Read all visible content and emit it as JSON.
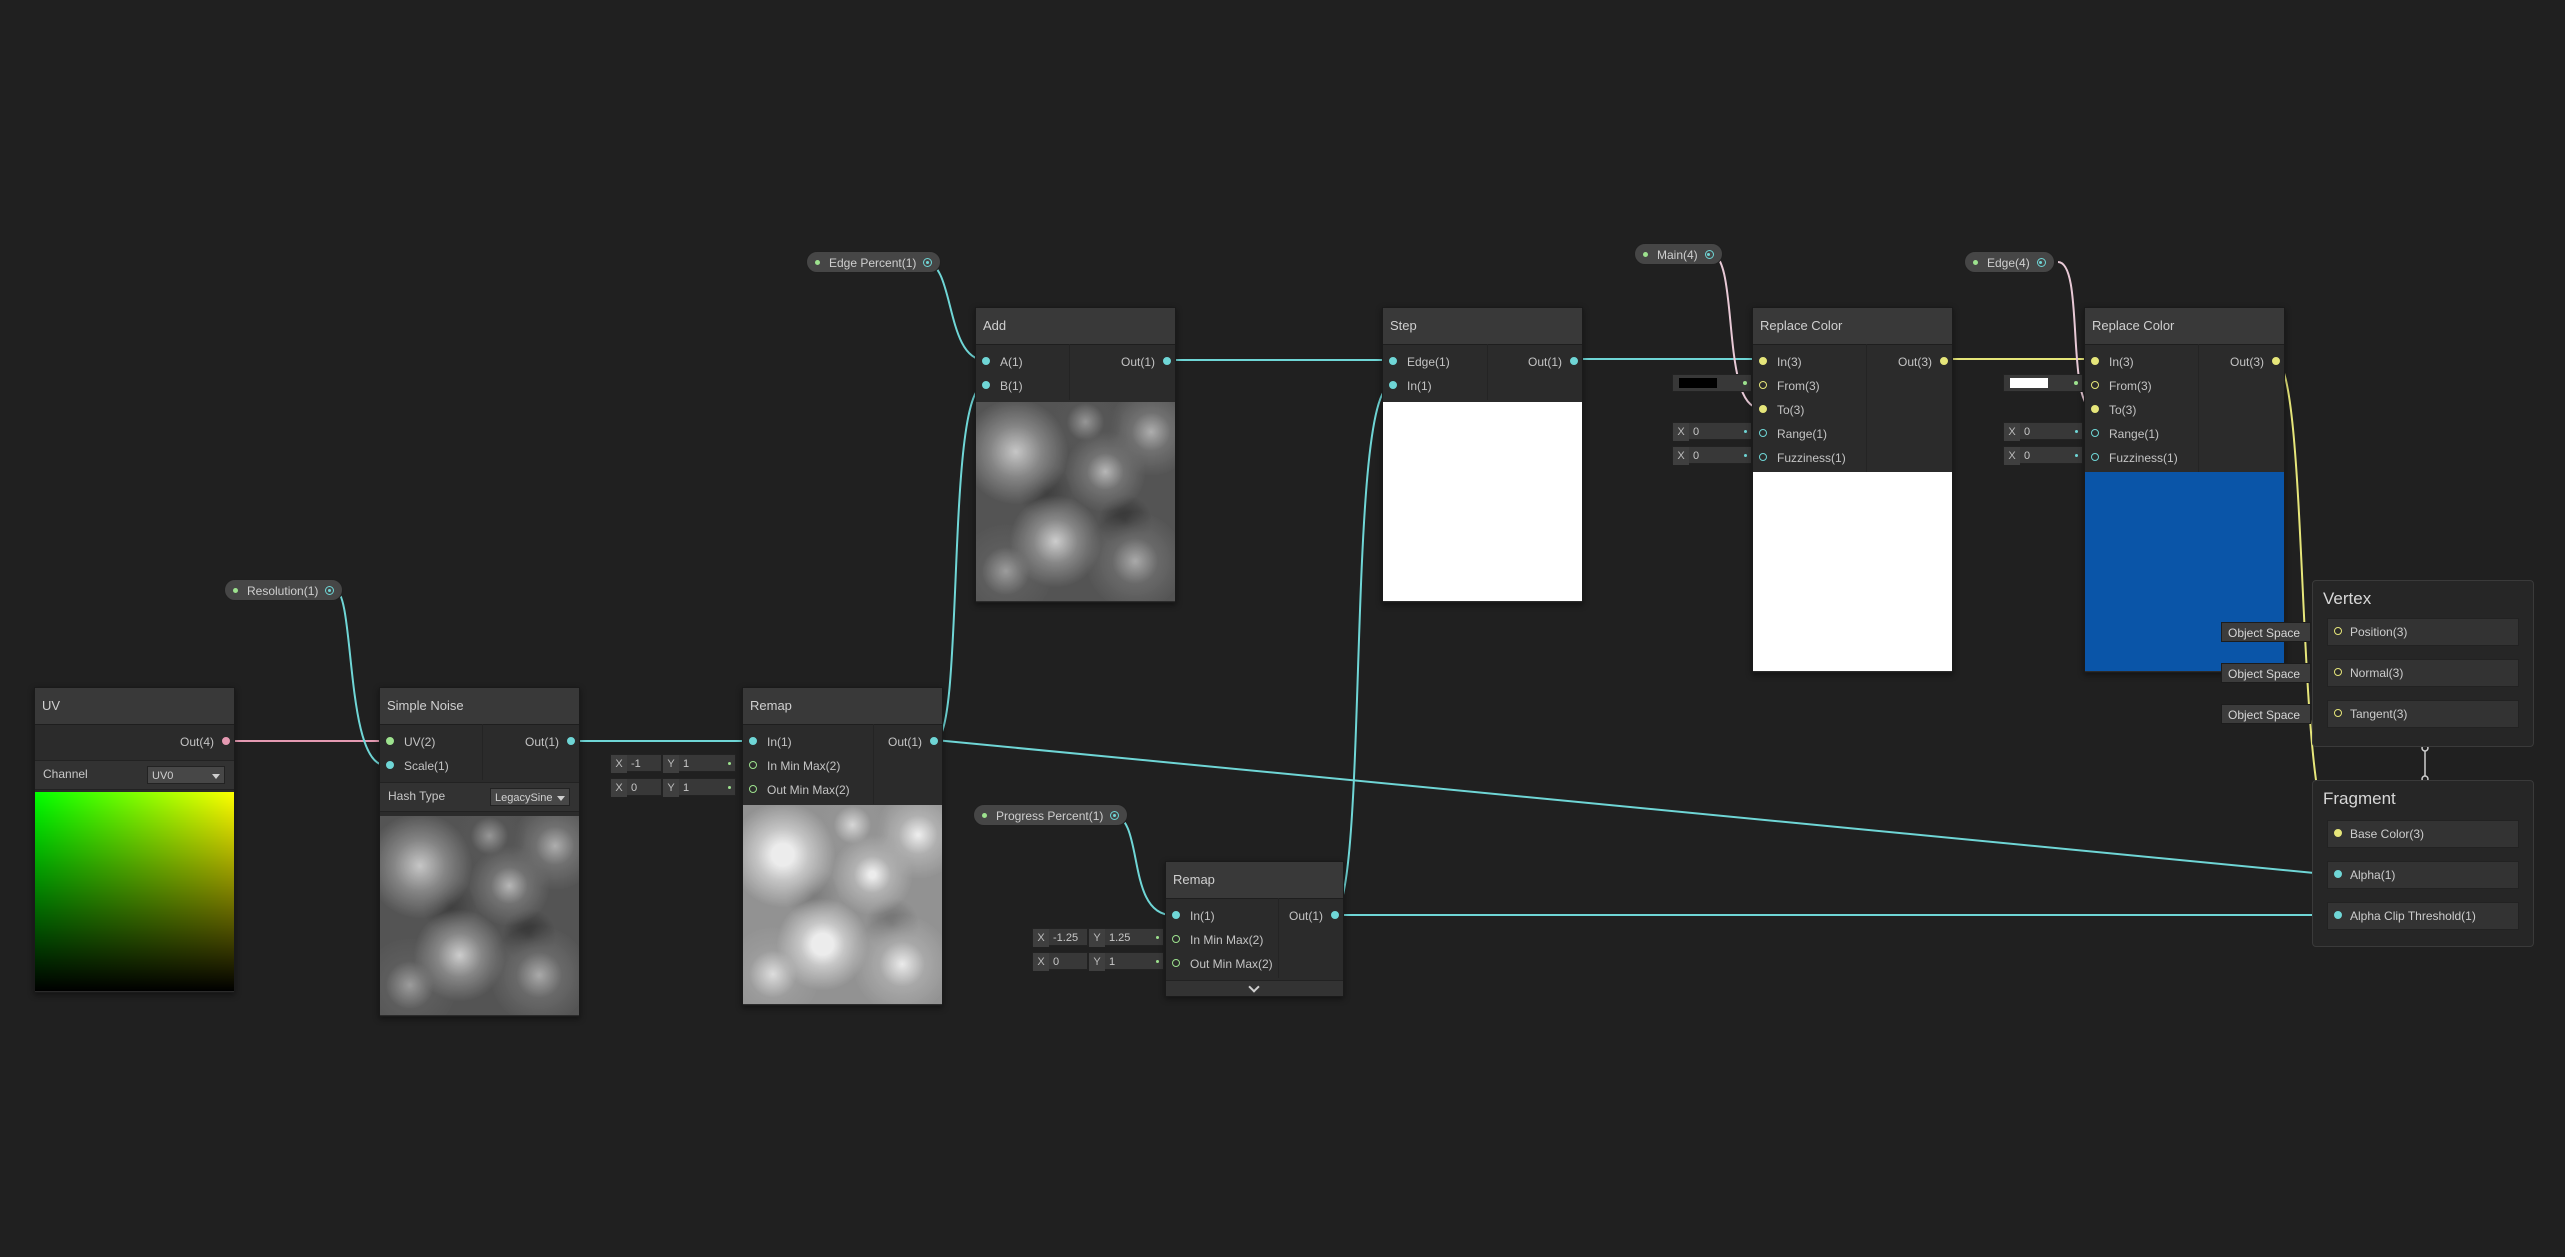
{
  "colors": {
    "wire_float": "#6fd6d6",
    "wire_vec3": "#e6e67a",
    "wire_vec4": "#e59ab2",
    "wire_vec2": "#9de28e",
    "background": "#202020",
    "base_color_preview": "#0a55a8"
  },
  "properties": {
    "edge_percent": "Edge Percent(1)",
    "resolution": "Resolution(1)",
    "progress_percent": "Progress Percent(1)",
    "main": "Main(4)",
    "edge": "Edge(4)"
  },
  "uv_node": {
    "title": "UV",
    "out": "Out(4)",
    "channel_label": "Channel",
    "channel_value": "UV0"
  },
  "simple_noise": {
    "title": "Simple Noise",
    "in_uv": "UV(2)",
    "in_scale": "Scale(1)",
    "out": "Out(1)",
    "hash_label": "Hash Type",
    "hash_value": "LegacySine"
  },
  "remap1": {
    "title": "Remap",
    "in": "In(1)",
    "in_min_max": "In Min Max(2)",
    "out_min_max": "Out Min Max(2)",
    "out": "Out(1)",
    "in_mm_x_label": "X",
    "in_mm_x": "-1",
    "in_mm_y_label": "Y",
    "in_mm_y": "1",
    "out_mm_x_label": "X",
    "out_mm_x": "0",
    "out_mm_y_label": "Y",
    "out_mm_y": "1"
  },
  "add_node": {
    "title": "Add",
    "in_a": "A(1)",
    "in_b": "B(1)",
    "out": "Out(1)"
  },
  "step_node": {
    "title": "Step",
    "in_edge": "Edge(1)",
    "in_in": "In(1)",
    "out": "Out(1)"
  },
  "remap2": {
    "title": "Remap",
    "in": "In(1)",
    "in_min_max": "In Min Max(2)",
    "out_min_max": "Out Min Max(2)",
    "out": "Out(1)",
    "in_mm_x_label": "X",
    "in_mm_x": "-1.25",
    "in_mm_y_label": "Y",
    "in_mm_y": "1.25",
    "out_mm_x_label": "X",
    "out_mm_x": "0",
    "out_mm_y_label": "Y",
    "out_mm_y": "1"
  },
  "replace1": {
    "title": "Replace Color",
    "in": "In(3)",
    "from": "From(3)",
    "to": "To(3)",
    "range": "Range(1)",
    "fuzziness": "Fuzziness(1)",
    "out": "Out(3)",
    "range_x_label": "X",
    "range_x": "0",
    "fuzz_x_label": "X",
    "fuzz_x": "0",
    "from_color": "#000000"
  },
  "replace2": {
    "title": "Replace Color",
    "in": "In(3)",
    "from": "From(3)",
    "to": "To(3)",
    "range": "Range(1)",
    "fuzziness": "Fuzziness(1)",
    "out": "Out(3)",
    "range_x_label": "X",
    "range_x": "0",
    "fuzz_x_label": "X",
    "fuzz_x": "0",
    "from_color": "#ffffff"
  },
  "vertex": {
    "title": "Vertex",
    "slots": [
      "Position(3)",
      "Normal(3)",
      "Tangent(3)"
    ],
    "space": "Object Space"
  },
  "fragment": {
    "title": "Fragment",
    "slots": [
      "Base Color(3)",
      "Alpha(1)",
      "Alpha Clip Threshold(1)"
    ]
  }
}
